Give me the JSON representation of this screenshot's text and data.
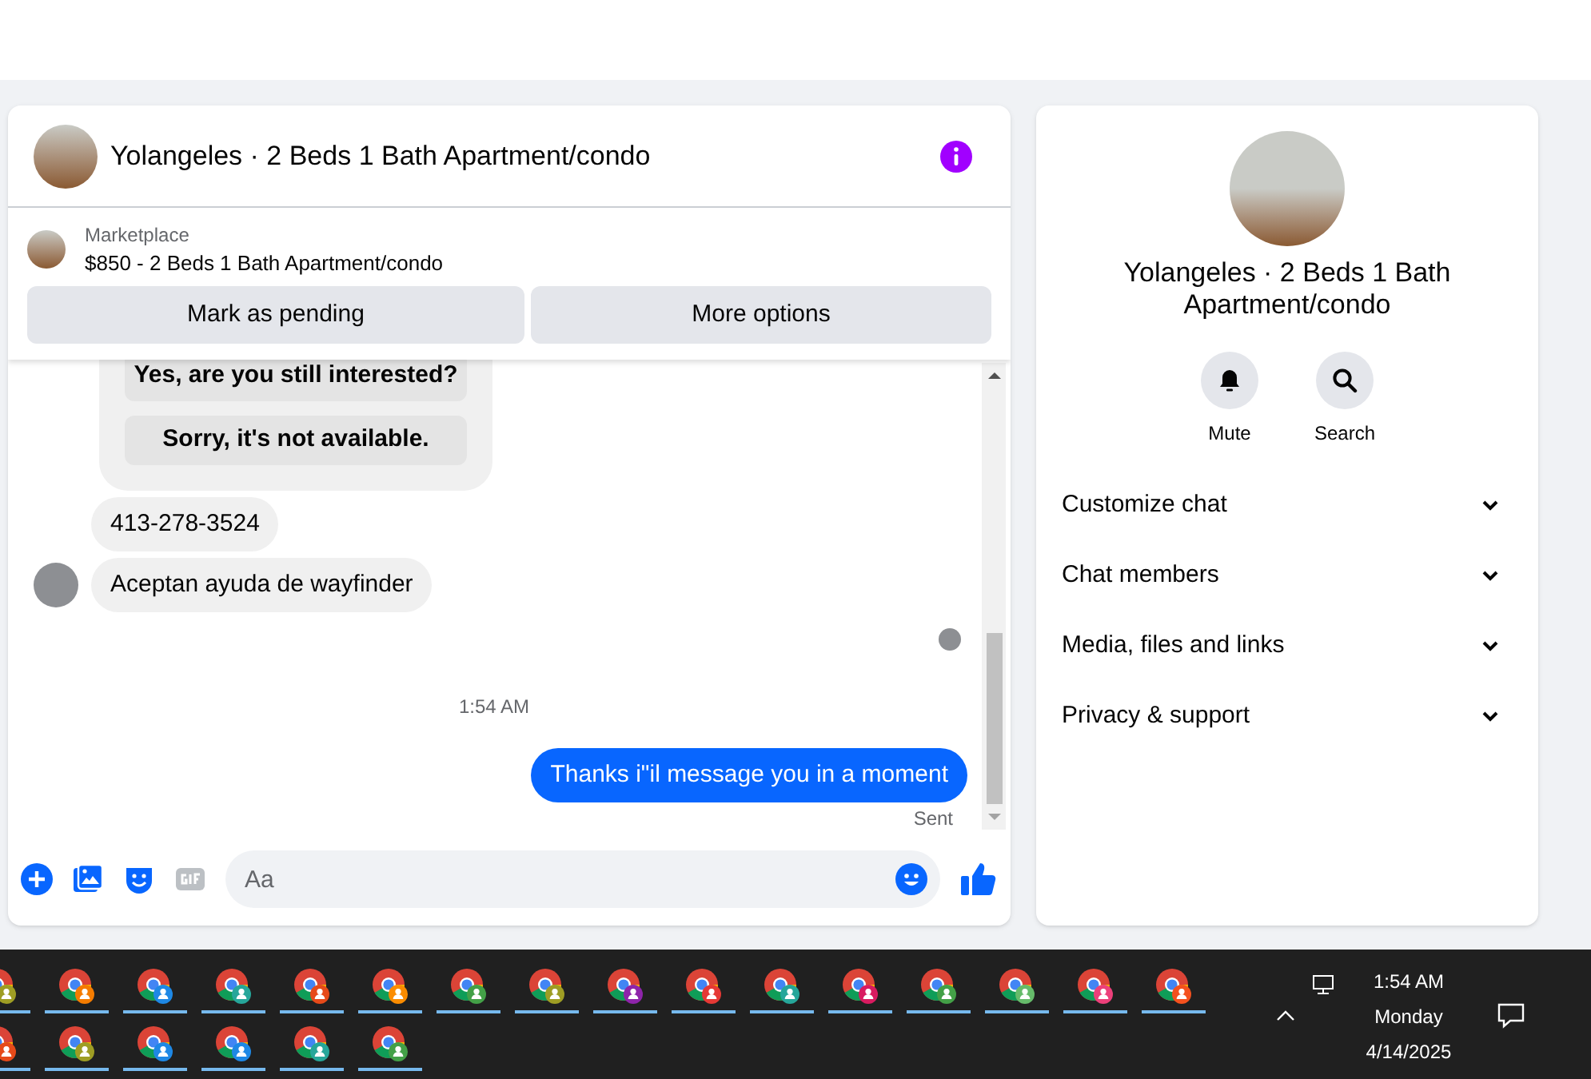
{
  "chat": {
    "title": "Yolangeles · 2 Beds 1 Bath Apartment/condo",
    "listing": {
      "source": "Marketplace",
      "description": "$850 - 2 Beds 1 Bath Apartment/condo",
      "actions": [
        "Mark as pending",
        "More options"
      ]
    },
    "messages": [
      {
        "kind": "quick_replies",
        "replies": [
          "Yes, are you still interested?",
          "Sorry, it's not available."
        ]
      },
      {
        "kind": "incoming",
        "text": "413-278-3524",
        "avatar": false
      },
      {
        "kind": "incoming",
        "text": "Aceptan ayuda de wayfinder",
        "avatar": true
      },
      {
        "kind": "seen"
      },
      {
        "kind": "timestamp",
        "text": "1:54 AM"
      },
      {
        "kind": "outgoing",
        "text": "Thanks i\"il message you in a moment"
      },
      {
        "kind": "status",
        "text": "Sent"
      }
    ],
    "composer": {
      "placeholder": "Aa"
    }
  },
  "details": {
    "title": "Yolangeles · 2 Beds 1 Bath Apartment/condo",
    "actions": [
      {
        "kind": "mute",
        "label": "Mute"
      },
      {
        "kind": "search",
        "label": "Search"
      }
    ],
    "sections": [
      {
        "label": "Customize chat",
        "expanded": false
      },
      {
        "label": "Chat members",
        "expanded": false
      },
      {
        "label": "Media, files and links",
        "expanded": false
      },
      {
        "label": "Privacy & support",
        "expanded": false
      }
    ]
  },
  "taskbar": {
    "apps": [
      {
        "color": "#9e9d24"
      },
      {
        "color": "#f57c00"
      },
      {
        "color": "#1e88e5"
      },
      {
        "color": "#26a69a"
      },
      {
        "color": "#e64a19"
      },
      {
        "color": "#fb8c00"
      },
      {
        "color": "#43a047"
      },
      {
        "color": "#9e9d24"
      },
      {
        "color": "#8e24aa"
      },
      {
        "color": "#e53935"
      },
      {
        "color": "#26a69a"
      },
      {
        "color": "#d81b60"
      },
      {
        "color": "#43a047"
      },
      {
        "color": "#66bb6a"
      },
      {
        "color": "#ec407a"
      },
      {
        "color": "#f4511e"
      },
      {
        "color": "#e64a19"
      },
      {
        "color": "#9e9d24"
      },
      {
        "color": "#1e88e5"
      },
      {
        "color": "#1e88e5"
      },
      {
        "color": "#26a69a"
      },
      {
        "color": "#43a047"
      }
    ],
    "time": "1:54 AM",
    "day": "Monday",
    "date": "4/14/2025"
  }
}
